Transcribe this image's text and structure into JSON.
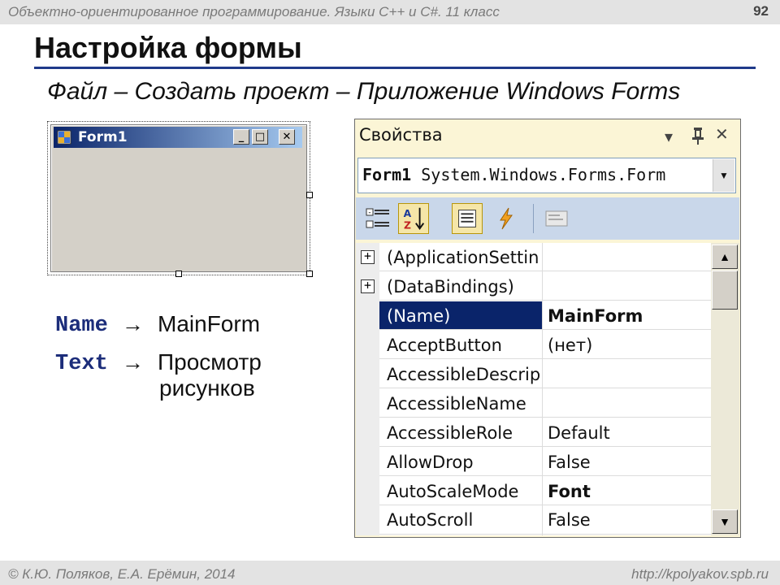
{
  "header": {
    "course": "Объектно-ориентированное программирование. Языки C++ и C#. 11 класс",
    "page_number": "92"
  },
  "slide": {
    "title": "Настройка формы",
    "subtitle": "Файл – Создать проект – Приложение Windows Forms"
  },
  "form_preview": {
    "title": "Form1",
    "buttons": [
      "_",
      "□",
      "✕"
    ]
  },
  "notes": [
    {
      "keyword": "Name",
      "arrow": "→",
      "value": "MainForm"
    },
    {
      "keyword": "Text",
      "arrow": "→",
      "value_line1": "Просмотр",
      "value_line2": "рисунков"
    }
  ],
  "properties_panel": {
    "title": "Свойства",
    "title_icons": {
      "dropdown": "▾",
      "pin": "📌",
      "close": "✕"
    },
    "object_name": "Form1",
    "object_type": "System.Windows.Forms.Form",
    "toolbar_icons": [
      "categorized-icon",
      "alphabetical-icon",
      "properties-icon",
      "events-icon",
      "property-pages-icon"
    ],
    "rows": [
      {
        "name": "(ApplicationSetting",
        "value": "",
        "expandable": true
      },
      {
        "name": "(DataBindings)",
        "value": "",
        "expandable": true
      },
      {
        "name": "(Name)",
        "value": "MainForm",
        "selected": true,
        "bold": true
      },
      {
        "name": "AcceptButton",
        "value": "(нет)"
      },
      {
        "name": "AccessibleDescripti",
        "value": ""
      },
      {
        "name": "AccessibleName",
        "value": ""
      },
      {
        "name": "AccessibleRole",
        "value": "Default"
      },
      {
        "name": "AllowDrop",
        "value": "False"
      },
      {
        "name": "AutoScaleMode",
        "value": "Font",
        "bold": true
      },
      {
        "name": "AutoScroll",
        "value": "False"
      }
    ],
    "expander_symbol": "+",
    "scroll_up": "▲",
    "scroll_down": "▼"
  },
  "footer": {
    "authors": "© К.Ю. Поляков, Е.А. Ерёмин, 2014",
    "url": "http://kpolyakov.spb.ru"
  },
  "colors": {
    "title_underline": "#1f3a8a",
    "keyword": "#1c2d7a",
    "selection": "#0a246a",
    "panel_bg": "#fbf5d6",
    "toolbar_bg": "#c9d7ea"
  }
}
